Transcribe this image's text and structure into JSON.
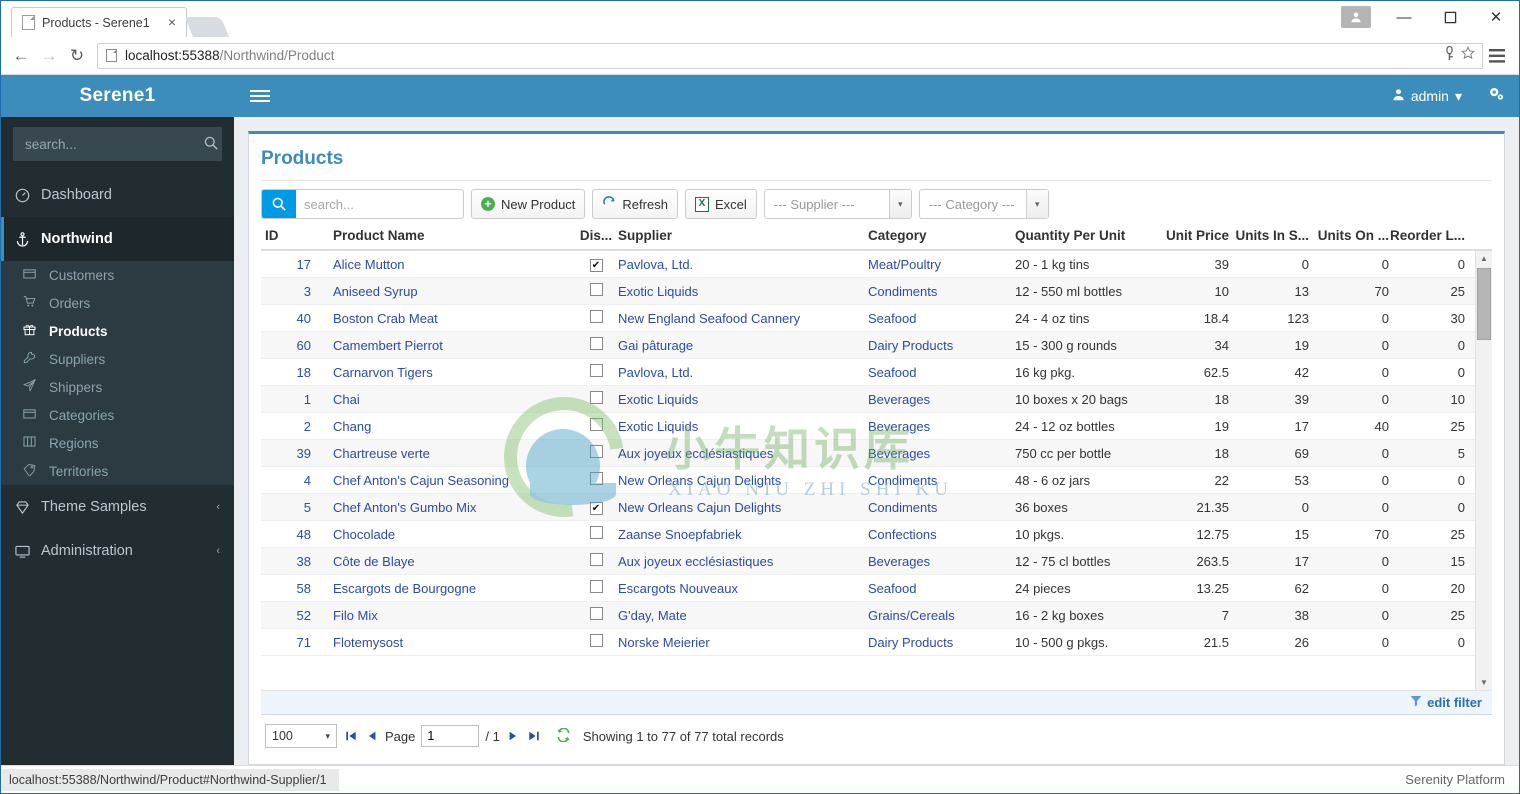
{
  "browser": {
    "tab_title": "Products - Serene1",
    "tab_close": "×",
    "url_host": "localhost:55388",
    "url_path": "/Northwind/Product",
    "back_icon": "←",
    "forward_icon": "→",
    "reload_icon": "↻",
    "minimize": "—",
    "maximize": "☐",
    "close": "✕",
    "user_icon": "●",
    "key_icon": "⚿",
    "star_icon": "☆",
    "menu_icon": "≡"
  },
  "sidebar": {
    "brand": "Serene1",
    "search_placeholder": "search...",
    "search_value": "",
    "search_icon": "⚲",
    "items": [
      {
        "label": "Dashboard",
        "icon": "◔",
        "caret": ""
      },
      {
        "label": "Northwind",
        "icon": "⚓",
        "caret": "ⱟ"
      },
      {
        "label": "Theme Samples",
        "icon": "◆",
        "caret": "‹"
      },
      {
        "label": "Administration",
        "icon": "▣",
        "caret": "‹"
      }
    ],
    "northwind_children": [
      {
        "label": "Customers",
        "icon": "▤"
      },
      {
        "label": "Orders",
        "icon": "⛃"
      },
      {
        "label": "Products",
        "icon": "☗"
      },
      {
        "label": "Suppliers",
        "icon": "⚒"
      },
      {
        "label": "Shippers",
        "icon": "✈"
      },
      {
        "label": "Categories",
        "icon": "▤"
      },
      {
        "label": "Regions",
        "icon": "⌸"
      },
      {
        "label": "Territories",
        "icon": "◇"
      }
    ]
  },
  "topbar": {
    "user": "admin",
    "user_caret": "▾",
    "user_icon": "●",
    "gear_icon": "⚙"
  },
  "page": {
    "title": "Products"
  },
  "toolbar": {
    "search_placeholder": "search...",
    "search_value": "",
    "search_icon": "⚲",
    "new_label": "New Product",
    "new_icon": "+",
    "refresh_label": "Refresh",
    "refresh_icon": "↻",
    "excel_label": "Excel",
    "excel_icon": "X",
    "supplier_filter": "--- Supplier ---",
    "category_filter": "--- Category ---",
    "arrow": "▾"
  },
  "grid": {
    "columns": [
      "ID",
      "Product Name",
      "Dis...",
      "Supplier",
      "Category",
      "Quantity Per Unit",
      "Unit Price",
      "Units In S...",
      "Units On ...",
      "Reorder L..."
    ],
    "checked_glyph": "✔",
    "rows": [
      {
        "id": "17",
        "name": "Alice Mutton",
        "discontinued": true,
        "supplier": "Pavlova, Ltd.",
        "category": "Meat/Poultry",
        "qpu": "20 - 1 kg tins",
        "price": "39",
        "in_stock": "0",
        "on_order": "0",
        "reorder": "0"
      },
      {
        "id": "3",
        "name": "Aniseed Syrup",
        "discontinued": false,
        "supplier": "Exotic Liquids",
        "category": "Condiments",
        "qpu": "12 - 550 ml bottles",
        "price": "10",
        "in_stock": "13",
        "on_order": "70",
        "reorder": "25"
      },
      {
        "id": "40",
        "name": "Boston Crab Meat",
        "discontinued": false,
        "supplier": "New England Seafood Cannery",
        "category": "Seafood",
        "qpu": "24 - 4 oz tins",
        "price": "18.4",
        "in_stock": "123",
        "on_order": "0",
        "reorder": "30"
      },
      {
        "id": "60",
        "name": "Camembert Pierrot",
        "discontinued": false,
        "supplier": "Gai pâturage",
        "category": "Dairy Products",
        "qpu": "15 - 300 g rounds",
        "price": "34",
        "in_stock": "19",
        "on_order": "0",
        "reorder": "0"
      },
      {
        "id": "18",
        "name": "Carnarvon Tigers",
        "discontinued": false,
        "supplier": "Pavlova, Ltd.",
        "category": "Seafood",
        "qpu": "16 kg pkg.",
        "price": "62.5",
        "in_stock": "42",
        "on_order": "0",
        "reorder": "0"
      },
      {
        "id": "1",
        "name": "Chai",
        "discontinued": false,
        "supplier": "Exotic Liquids",
        "category": "Beverages",
        "qpu": "10 boxes x 20 bags",
        "price": "18",
        "in_stock": "39",
        "on_order": "0",
        "reorder": "10"
      },
      {
        "id": "2",
        "name": "Chang",
        "discontinued": false,
        "supplier": "Exotic Liquids",
        "category": "Beverages",
        "qpu": "24 - 12 oz bottles",
        "price": "19",
        "in_stock": "17",
        "on_order": "40",
        "reorder": "25"
      },
      {
        "id": "39",
        "name": "Chartreuse verte",
        "discontinued": false,
        "supplier": "Aux joyeux ecclésiastiques",
        "category": "Beverages",
        "qpu": "750 cc per bottle",
        "price": "18",
        "in_stock": "69",
        "on_order": "0",
        "reorder": "5"
      },
      {
        "id": "4",
        "name": "Chef Anton's Cajun Seasoning",
        "discontinued": false,
        "supplier": "New Orleans Cajun Delights",
        "category": "Condiments",
        "qpu": "48 - 6 oz jars",
        "price": "22",
        "in_stock": "53",
        "on_order": "0",
        "reorder": "0"
      },
      {
        "id": "5",
        "name": "Chef Anton's Gumbo Mix",
        "discontinued": true,
        "supplier": "New Orleans Cajun Delights",
        "category": "Condiments",
        "qpu": "36 boxes",
        "price": "21.35",
        "in_stock": "0",
        "on_order": "0",
        "reorder": "0"
      },
      {
        "id": "48",
        "name": "Chocolade",
        "discontinued": false,
        "supplier": "Zaanse Snoepfabriek",
        "category": "Confections",
        "qpu": "10 pkgs.",
        "price": "12.75",
        "in_stock": "15",
        "on_order": "70",
        "reorder": "25"
      },
      {
        "id": "38",
        "name": "Côte de Blaye",
        "discontinued": false,
        "supplier": "Aux joyeux ecclésiastiques",
        "category": "Beverages",
        "qpu": "12 - 75 cl bottles",
        "price": "263.5",
        "in_stock": "17",
        "on_order": "0",
        "reorder": "15"
      },
      {
        "id": "58",
        "name": "Escargots de Bourgogne",
        "discontinued": false,
        "supplier": "Escargots Nouveaux",
        "category": "Seafood",
        "qpu": "24 pieces",
        "price": "13.25",
        "in_stock": "62",
        "on_order": "0",
        "reorder": "20"
      },
      {
        "id": "52",
        "name": "Filo Mix",
        "discontinued": false,
        "supplier": "G'day, Mate",
        "category": "Grains/Cereals",
        "qpu": "16 - 2 kg boxes",
        "price": "7",
        "in_stock": "38",
        "on_order": "0",
        "reorder": "25"
      },
      {
        "id": "71",
        "name": "Flotemysost",
        "discontinued": false,
        "supplier": "Norske Meierier",
        "category": "Dairy Products",
        "qpu": "10 - 500 g pkgs.",
        "price": "21.5",
        "in_stock": "26",
        "on_order": "0",
        "reorder": "0"
      }
    ]
  },
  "filterbar": {
    "edit_filter": "edit filter",
    "funnel_icon": "▽"
  },
  "pager": {
    "page_size": "100",
    "page_size_arrow": "▾",
    "first_icon": "⏮",
    "prev_icon": "◂",
    "page_label": "Page",
    "page_value": "1",
    "page_total": "/ 1",
    "next_icon": "▸",
    "last_icon": "⏭",
    "refresh_icon": "♻",
    "status": "Showing 1 to 77 of 77 total records"
  },
  "statusbar": {
    "url": "localhost:55388/Northwind/Product#Northwind-Supplier/1",
    "platform": "Serenity Platform"
  },
  "watermark": {
    "text": "小牛知识库",
    "sub": "XIAO NIU ZHI SHI KU"
  },
  "colors": {
    "brand_blue": "#3c8dbc",
    "sidebar_dark": "#222d32",
    "submenu": "#2c3b41",
    "link_blue": "#2a4bab",
    "accent_cyan": "#0099e5"
  }
}
